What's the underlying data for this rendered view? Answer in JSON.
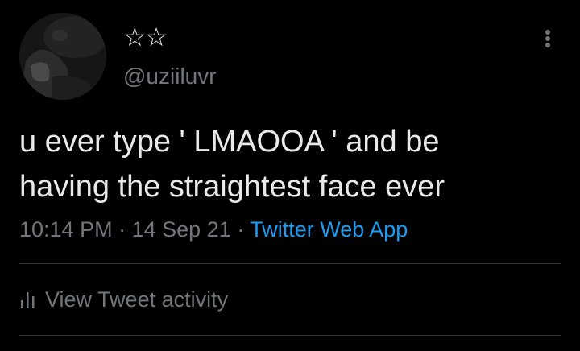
{
  "tweet": {
    "author": {
      "display_name": "☆☆",
      "handle": "@uziiluvr",
      "avatar_icon": "profile-photo"
    },
    "more_icon": "more-vertical-icon",
    "text_lines": [
      "u ever type ' LMAOOA ' and be",
      "having the straightest face ever"
    ],
    "meta": {
      "time": "10:14 PM",
      "separator": " · ",
      "date": "14 Sep 21",
      "source": "Twitter Web App"
    },
    "activity": {
      "icon": "bar-chart-icon",
      "label": "View Tweet activity"
    }
  },
  "colors": {
    "background": "#000000",
    "text_primary": "#e7e9ea",
    "text_secondary": "#71767b",
    "link": "#1d9bf0",
    "divider": "#2f3336"
  }
}
